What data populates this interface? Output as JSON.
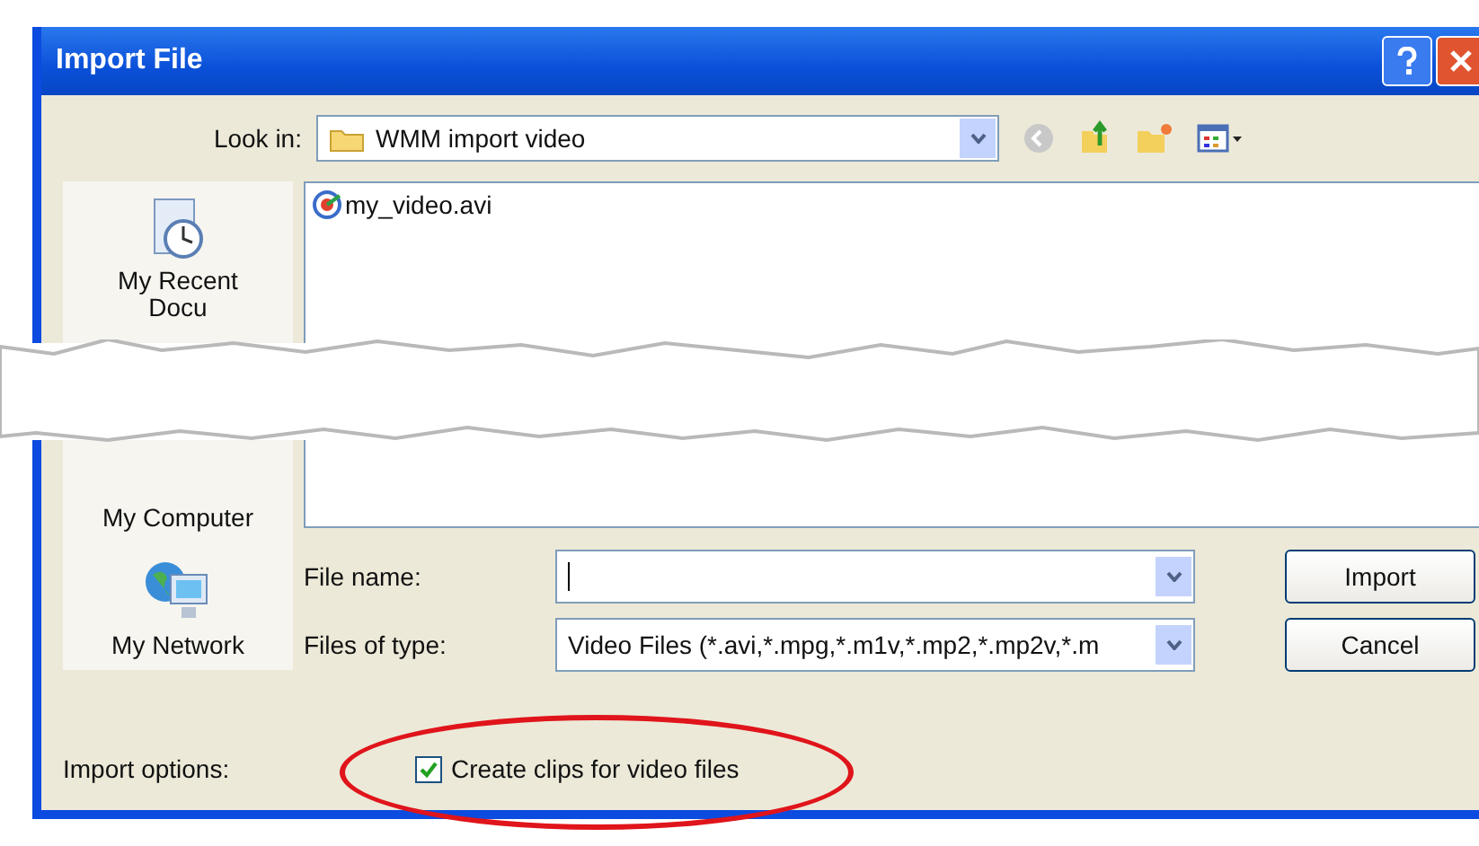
{
  "window": {
    "title": "Import File"
  },
  "look_in": {
    "label": "Look in:",
    "value": "WMM import video"
  },
  "places": [
    {
      "kind": "recent",
      "label": "My Recent Docu"
    },
    {
      "kind": "computer",
      "label": "My Computer"
    },
    {
      "kind": "network",
      "label": "My Network"
    }
  ],
  "files": [
    {
      "name": "my_video.avi"
    }
  ],
  "file_name": {
    "label": "File name:"
  },
  "file_type": {
    "label": "Files of type:",
    "value": "Video Files (*.avi,*.mpg,*.m1v,*.mp2,*.mp2v,*.m"
  },
  "buttons": [
    "Import",
    "Cancel"
  ],
  "import_options": {
    "label": "Import options:",
    "checkbox": {
      "label": "Create clips for video files",
      "checked": true
    }
  }
}
